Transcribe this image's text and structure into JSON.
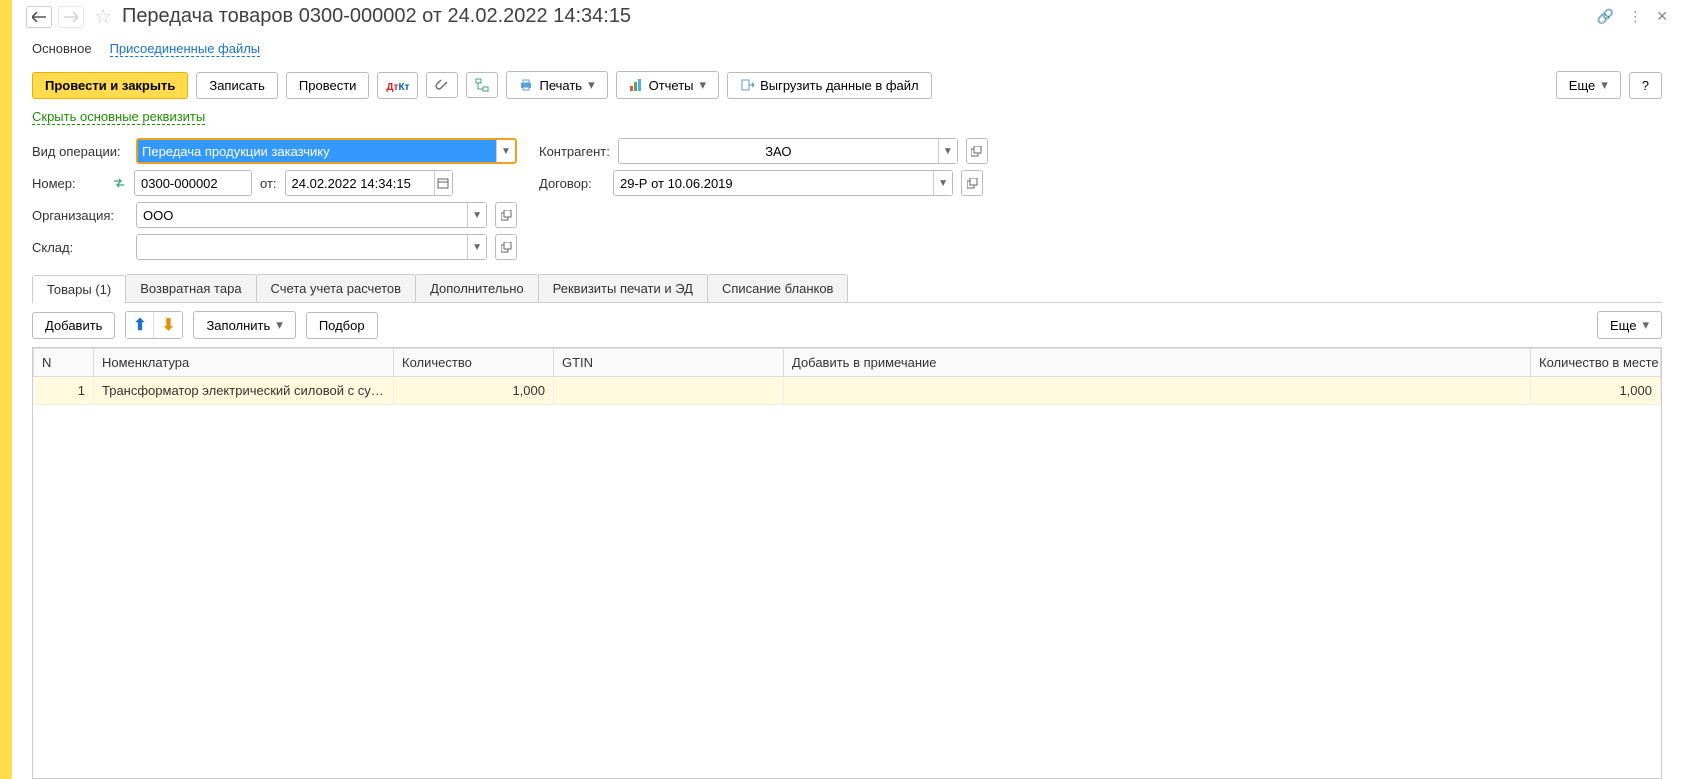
{
  "doc_title": "Передача товаров 0300-000002 от 24.02.2022 14:34:15",
  "nav": {
    "main": "Основное",
    "files": "Присоединенные файлы"
  },
  "toolbar": {
    "post_close": "Провести и закрыть",
    "save": "Записать",
    "post": "Провести",
    "print": "Печать",
    "reports": "Отчеты",
    "export": "Выгрузить данные в файл",
    "more": "Еще",
    "help": "?"
  },
  "hide_link": "Скрыть основные реквизиты",
  "form": {
    "op_label": "Вид операции:",
    "op_value": "Передача продукции заказчику",
    "partner_label": "Контрагент:",
    "partner_value": "ЗАО",
    "num_label": "Номер:",
    "num_value": "0300-000002",
    "from_label": "от:",
    "date_value": "24.02.2022 14:34:15",
    "contract_label": "Договор:",
    "contract_value": "29-Р от 10.06.2019",
    "org_label": "Организация:",
    "org_value": "ООО",
    "wh_label": "Склад:",
    "wh_value": ""
  },
  "tabs": {
    "goods": "Товары (1)",
    "tare": "Возвратная тара",
    "accounts": "Счета учета расчетов",
    "extra": "Дополнительно",
    "print_req": "Реквизиты печати и ЭД",
    "blanks": "Списание бланков"
  },
  "tbl_toolbar": {
    "add": "Добавить",
    "fill": "Заполнить",
    "pick": "Подбор",
    "more": "Еще"
  },
  "table": {
    "cols": {
      "n": "N",
      "nom": "Номенклатура",
      "qty": "Количество",
      "gtin": "GTIN",
      "note": "Добавить в примечание",
      "qty_place": "Количество в месте"
    },
    "rows": [
      {
        "n": "1",
        "nom": "Трансформатор электрический силовой с сухим д...",
        "qty": "1,000",
        "gtin": "",
        "note": "",
        "qty_place": "1,000"
      }
    ]
  }
}
